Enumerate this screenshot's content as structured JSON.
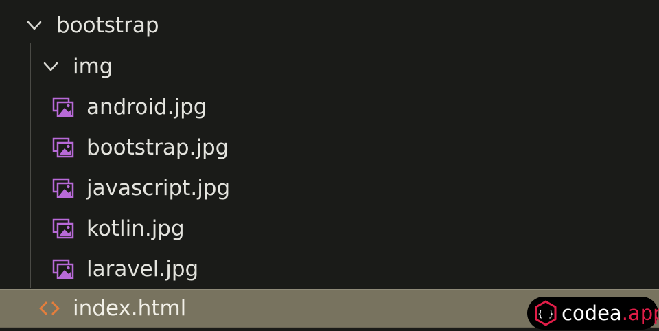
{
  "explorer": {
    "root_folder": {
      "label": "bootstrap",
      "expanded": true,
      "icon": "chevron-down-icon"
    },
    "subfolder": {
      "label": "img",
      "expanded": true,
      "icon": "chevron-down-icon"
    },
    "files": [
      {
        "label": "android.jpg",
        "icon": "image-file-icon"
      },
      {
        "label": "bootstrap.jpg",
        "icon": "image-file-icon"
      },
      {
        "label": "javascript.jpg",
        "icon": "image-file-icon"
      },
      {
        "label": "kotlin.jpg",
        "icon": "image-file-icon"
      },
      {
        "label": "laravel.jpg",
        "icon": "image-file-icon"
      }
    ],
    "selected_file": {
      "label": "index.html",
      "icon": "html-code-icon",
      "selected": true
    }
  },
  "brand": {
    "name": "codea",
    "domain": ".app",
    "mark_text": "{ }",
    "icon": "codea-logo-icon"
  },
  "colors": {
    "background": "#1a1b18",
    "text": "#e4e4de",
    "selection": "#78735f",
    "image_icon": "#b86ad8",
    "html_icon": "#e57e3c",
    "brand_accent": "#e11d48"
  }
}
